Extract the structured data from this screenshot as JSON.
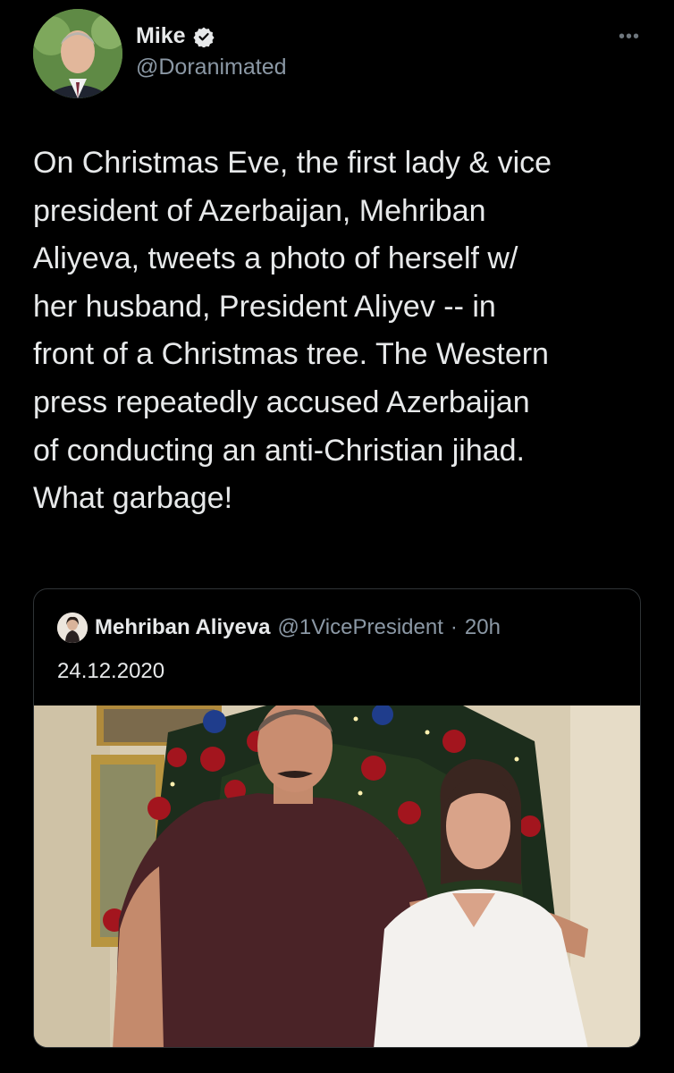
{
  "tweet": {
    "author": {
      "name": "Mike",
      "handle": "@Doranimated",
      "verified_icon": "verified-badge-icon"
    },
    "more_icon": "more-options-icon",
    "text": "On Christmas Eve, the first lady & vice\npresident of Azerbaijan, Mehriban\nAliyeva, tweets a photo of herself w/\nher husband, President Aliyev -- in\nfront of a Christmas tree. The Western\npress repeatedly accused Azerbaijan\nof conducting an anti-Christian jihad.\nWhat garbage!"
  },
  "quoted_tweet": {
    "author": {
      "name": "Mehriban Aliyeva",
      "handle": "@1VicePresident"
    },
    "separator": "·",
    "time": "20h",
    "text": "24.12.2020"
  },
  "colors": {
    "background": "#000000",
    "text": "#e7e9ea",
    "secondary": "#8b98a5",
    "border": "#2f3336"
  }
}
